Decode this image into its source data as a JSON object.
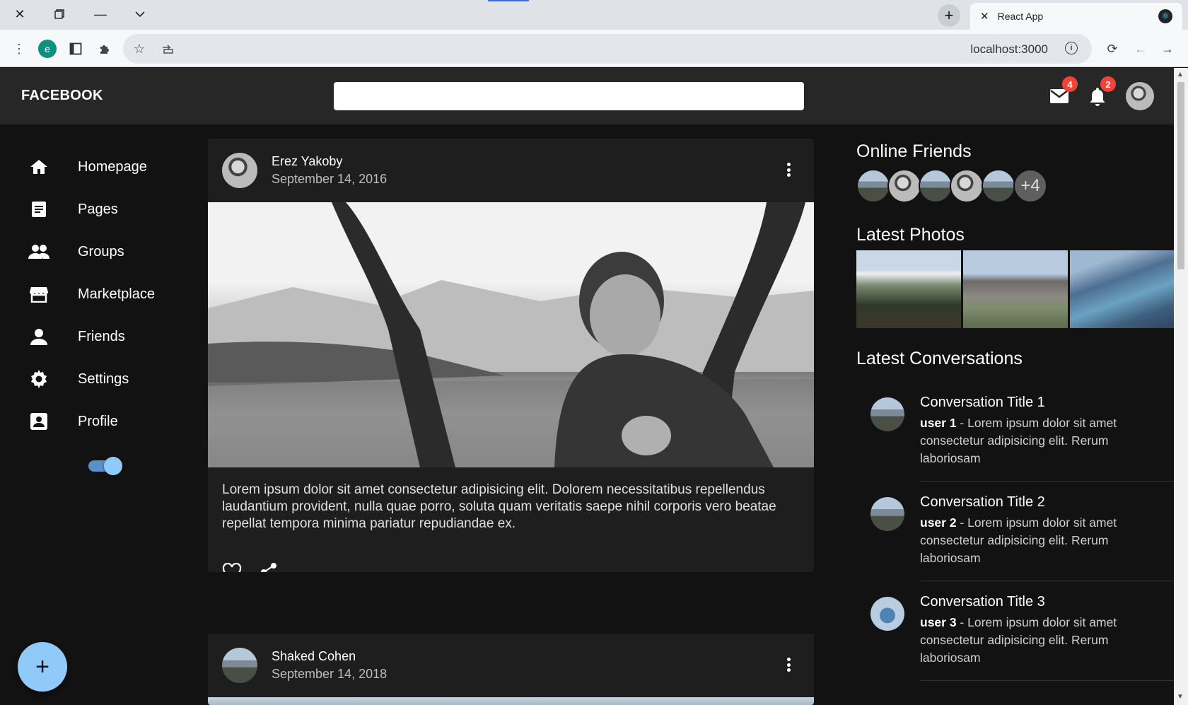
{
  "browser": {
    "tab_title": "React App",
    "url": "localhost:3000",
    "profile_letter": "e"
  },
  "app": {
    "logo": "FACEBOOK",
    "search_placeholder": "",
    "mail_count": "4",
    "notification_count": "2"
  },
  "sidebar": {
    "items": [
      {
        "label": "Homepage",
        "icon": "home-icon"
      },
      {
        "label": "Pages",
        "icon": "pages-icon"
      },
      {
        "label": "Groups",
        "icon": "groups-icon"
      },
      {
        "label": "Marketplace",
        "icon": "store-icon"
      },
      {
        "label": "Friends",
        "icon": "person-icon"
      },
      {
        "label": "Settings",
        "icon": "gear-icon"
      },
      {
        "label": "Profile",
        "icon": "profile-icon"
      }
    ],
    "dark_mode_on": true,
    "fab_label": "+"
  },
  "posts": [
    {
      "author": "Erez Yakoby",
      "date": "September 14, 2016",
      "text": "Lorem ipsum dolor sit amet consectetur adipisicing elit. Dolorem necessitatibus repellendus laudantium provident, nulla quae porro, soluta quam veritatis saepe nihil corporis vero beatae repellat tempora minima pariatur repudiandae ex."
    },
    {
      "author": "Shaked Cohen",
      "date": "September 14, 2018"
    }
  ],
  "right_panel": {
    "online_friends_title": "Online Friends",
    "online_friends_more": "+4",
    "latest_photos_title": "Latest Photos",
    "latest_conversations_title": "Latest Conversations",
    "conversations": [
      {
        "title": "Conversation Title 1",
        "user": "user 1",
        "text": " - Lorem ipsum dolor sit amet consectetur adipisicing elit. Rerum laboriosam"
      },
      {
        "title": "Conversation Title 2",
        "user": "user 2",
        "text": " - Lorem ipsum dolor sit amet consectetur adipisicing elit. Rerum laboriosam"
      },
      {
        "title": "Conversation Title 3",
        "user": "user 3",
        "text": " - Lorem ipsum dolor sit amet consectetur adipisicing elit. Rerum laboriosam"
      }
    ]
  },
  "colors": {
    "background": "#121212",
    "topbar": "#272727",
    "card": "#1e1e1e",
    "accent": "#90caf9",
    "badge": "#f44336"
  }
}
